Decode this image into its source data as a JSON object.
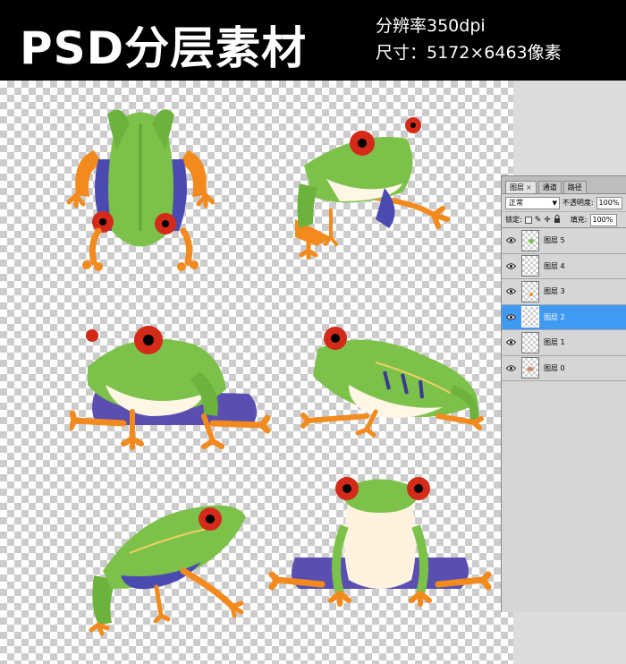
{
  "banner": {
    "title": "PSD分层素材",
    "resolution": "分辨率350dpi",
    "size": "尺寸：5172×6463像素"
  },
  "colors": {
    "frog_green": "#7cc24a",
    "frog_dark_green": "#4e9a2d",
    "frog_orange": "#f28a1e",
    "frog_blue": "#4a4ab0",
    "frog_eye_red": "#d42a1a",
    "selection_blue": "#3f9af2"
  },
  "layers_panel": {
    "tabs": [
      {
        "label": "图层",
        "close": "×"
      },
      {
        "label": "通道"
      },
      {
        "label": "路径"
      }
    ],
    "blend_mode": "正常",
    "opacity_label": "不透明度:",
    "opacity_value": "100%",
    "lock_label": "锁定:",
    "fill_label": "填充:",
    "fill_value": "100%",
    "layers": [
      {
        "name": "图层 5",
        "visible": true,
        "selected": false
      },
      {
        "name": "图层 4",
        "visible": true,
        "selected": false
      },
      {
        "name": "图层 3",
        "visible": true,
        "selected": false
      },
      {
        "name": "图层 2",
        "visible": true,
        "selected": true
      },
      {
        "name": "图层 1",
        "visible": true,
        "selected": false
      },
      {
        "name": "图层 0",
        "visible": true,
        "selected": false
      }
    ]
  },
  "icons": [
    "eye-icon",
    "lock-transparent-icon",
    "lock-brush-icon",
    "lock-move-icon",
    "lock-all-icon",
    "dropdown-arrow-icon"
  ]
}
